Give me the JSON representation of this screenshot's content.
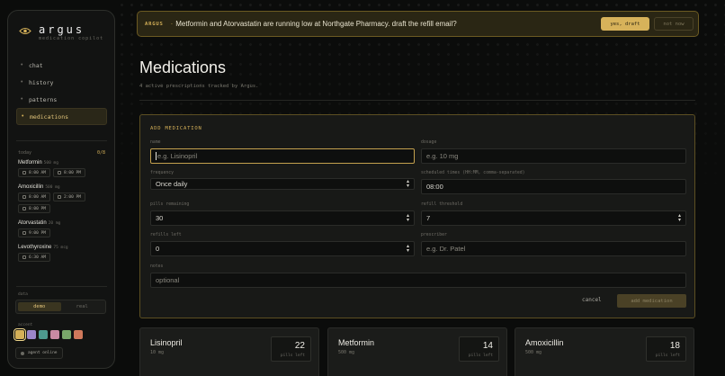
{
  "brand": {
    "name": "argus",
    "subtitle": "medication copilot"
  },
  "nav": [
    {
      "label": "chat",
      "active": false
    },
    {
      "label": "history",
      "active": false
    },
    {
      "label": "patterns",
      "active": false
    },
    {
      "label": "medications",
      "active": true
    }
  ],
  "today": {
    "label": "today",
    "count": "0/8",
    "meds": [
      {
        "name": "Metformin",
        "dose": "500 mg",
        "times": [
          "8:00 AM",
          "8:00 PM"
        ]
      },
      {
        "name": "Amoxicillin",
        "dose": "500 mg",
        "times": [
          "8:00 AM",
          "2:00 PM",
          "8:00 PM"
        ]
      },
      {
        "name": "Atorvastatin",
        "dose": "20 mg",
        "times": [
          "9:00 PM"
        ]
      },
      {
        "name": "Levothyroxine",
        "dose": "75 mcg",
        "times": [
          "6:30 AM"
        ]
      }
    ]
  },
  "data_section": {
    "label": "data",
    "options": [
      "demo",
      "real"
    ],
    "selected": "demo"
  },
  "accent": {
    "label": "accent",
    "colors": [
      "#d4b058",
      "#9a86c9",
      "#4d9a8e",
      "#c98aa3",
      "#79a86a",
      "#d0795b"
    ],
    "selected": 0
  },
  "agent_status": "agent online",
  "banner": {
    "who": "ARGUS",
    "message": "Metformin and Atorvastatin are running low at Northgate Pharmacy. draft the refill email?",
    "yes_label": "yes, draft",
    "no_label": "not now"
  },
  "page": {
    "title": "Medications",
    "subtitle": "4 active prescriptions tracked by Argus."
  },
  "form": {
    "title": "ADD MEDICATION",
    "name": {
      "label": "name",
      "placeholder": "e.g. Lisinopril"
    },
    "dosage": {
      "label": "dosage",
      "placeholder": "e.g. 10 mg"
    },
    "frequency": {
      "label": "frequency",
      "value": "Once daily"
    },
    "scheduled_times": {
      "label": "scheduled times (HH:MM, comma-separated)",
      "value": "08:00"
    },
    "pills_remaining": {
      "label": "pills remaining",
      "value": "30"
    },
    "refill_threshold": {
      "label": "refill threshold",
      "value": "7"
    },
    "refills_left": {
      "label": "refills left",
      "value": "0"
    },
    "prescriber": {
      "label": "prescriber",
      "placeholder": "e.g. Dr. Patel"
    },
    "notes": {
      "label": "notes",
      "placeholder": "optional"
    },
    "cancel_label": "cancel",
    "submit_label": "add medication"
  },
  "cards": [
    {
      "name": "Lisinopril",
      "dose": "10 mg",
      "pills": "22",
      "pills_label": "pills left"
    },
    {
      "name": "Metformin",
      "dose": "500 mg",
      "pills": "14",
      "pills_label": "pills left"
    },
    {
      "name": "Amoxicillin",
      "dose": "500 mg",
      "pills": "18",
      "pills_label": "pills left"
    }
  ]
}
